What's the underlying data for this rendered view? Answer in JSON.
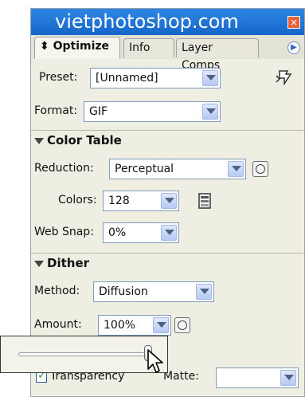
{
  "window": {
    "title": "vietphotoshop.com",
    "close_glyph": "×"
  },
  "tabs": [
    {
      "label": "⬍ Optimize",
      "active": true
    },
    {
      "label": "Info",
      "active": false
    },
    {
      "label": "Layer Comps",
      "active": false
    }
  ],
  "tab_menu_icon": "panel-menu-icon",
  "preset": {
    "label": "Preset:",
    "value": "[Unnamed]"
  },
  "format": {
    "label": "Format:",
    "value": "GIF"
  },
  "color_table": {
    "header": "Color Table",
    "reduction": {
      "label": "Reduction:",
      "value": "Perceptual"
    },
    "colors": {
      "label": "Colors:",
      "value": "128"
    },
    "web_snap": {
      "label": "Web Snap:",
      "value": "0%"
    }
  },
  "dither": {
    "header": "Dither",
    "method": {
      "label": "Method:",
      "value": "Diffusion"
    },
    "amount": {
      "label": "Amount:",
      "value": "100%"
    }
  },
  "amount_slider": {
    "value_fraction": 1.0
  },
  "transparency": {
    "label": "Transparency",
    "checked": true
  },
  "matte": {
    "label": "Matte:",
    "value": ""
  },
  "colors_accent": {
    "titlebar": "#1f74d8",
    "panel": "#eeeee2",
    "checkmark": "#2e9d2e"
  }
}
